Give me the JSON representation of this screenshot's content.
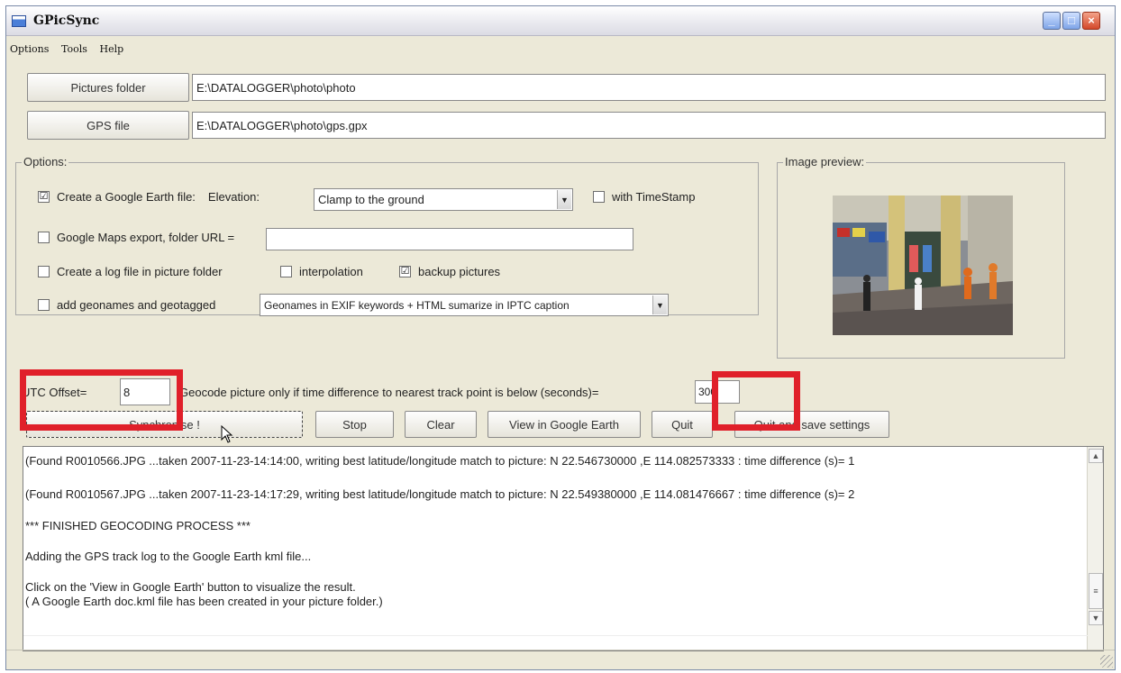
{
  "window": {
    "title": "GPicSync"
  },
  "menu": {
    "items": [
      "Options",
      "Tools",
      "Help"
    ]
  },
  "paths": {
    "pictures_label": "Pictures folder",
    "pictures_value": "E:\\DATALOGGER\\photo\\photo",
    "gps_label": "GPS file",
    "gps_value": "E:\\DATALOGGER\\photo\\gps.gpx"
  },
  "options": {
    "title": "Options:",
    "google_earth": {
      "label": "Create a Google Earth file:",
      "checked": "☑"
    },
    "elevation_label": "Elevation:",
    "elevation_value": "Clamp to the ground",
    "timestamp_label": "with TimeStamp",
    "google_maps_label": "Google Maps export, folder URL =",
    "logfile_label": "Create a log file in picture folder",
    "interpolation_label": "interpolation",
    "backup_label": "backup pictures",
    "geonames_label": "add geonames and geotagged",
    "geonames_value": "Geonames in EXIF keywords + HTML sumarize in IPTC caption"
  },
  "preview": {
    "title": "Image preview:"
  },
  "utc": {
    "label": "UTC Offset=",
    "value": "8",
    "geocode_label": "Geocode picture only if time difference to nearest track point is below (seconds)=",
    "seconds_value": "300"
  },
  "buttons": {
    "synchronise": "Synchronise !",
    "stop": "Stop",
    "clear": "Clear",
    "view_ge": "View in Google Earth",
    "quit": "Quit",
    "quit_save": "Quit and save settings"
  },
  "log": {
    "lines": [
      "(Found R0010566.JPG ...taken 2007-11-23-14:14:00, writing best latitude/longitude match to picture: N 22.546730000 ,E 114.082573333 : time difference (s)= 1",
      "(Found R0010567.JPG ...taken 2007-11-23-14:17:29, writing best latitude/longitude match to picture: N 22.549380000 ,E 114.081476667 : time difference (s)= 2",
      "*** FINISHED GEOCODING PROCESS ***",
      "Adding the GPS track log to the Google Earth kml file...",
      "Click on the 'View in Google Earth' button to visualize the result.",
      "( A Google Earth doc.kml file has been created in your picture folder.)"
    ]
  },
  "colors": {
    "highlight": "#e0202a",
    "window_bg": "#ece9d8"
  }
}
